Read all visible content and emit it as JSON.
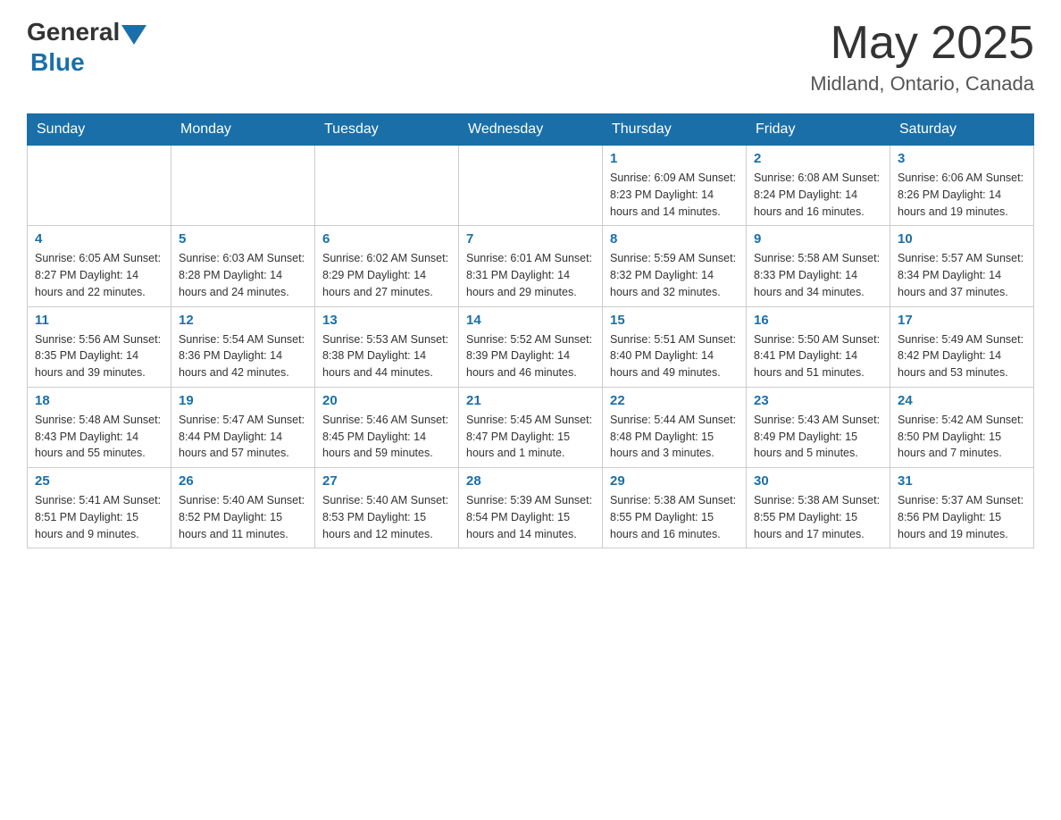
{
  "header": {
    "logo_general": "General",
    "logo_blue": "Blue",
    "month_year": "May 2025",
    "location": "Midland, Ontario, Canada"
  },
  "weekdays": [
    "Sunday",
    "Monday",
    "Tuesday",
    "Wednesday",
    "Thursday",
    "Friday",
    "Saturday"
  ],
  "weeks": [
    [
      {
        "day": "",
        "info": ""
      },
      {
        "day": "",
        "info": ""
      },
      {
        "day": "",
        "info": ""
      },
      {
        "day": "",
        "info": ""
      },
      {
        "day": "1",
        "info": "Sunrise: 6:09 AM\nSunset: 8:23 PM\nDaylight: 14 hours and 14 minutes."
      },
      {
        "day": "2",
        "info": "Sunrise: 6:08 AM\nSunset: 8:24 PM\nDaylight: 14 hours and 16 minutes."
      },
      {
        "day": "3",
        "info": "Sunrise: 6:06 AM\nSunset: 8:26 PM\nDaylight: 14 hours and 19 minutes."
      }
    ],
    [
      {
        "day": "4",
        "info": "Sunrise: 6:05 AM\nSunset: 8:27 PM\nDaylight: 14 hours and 22 minutes."
      },
      {
        "day": "5",
        "info": "Sunrise: 6:03 AM\nSunset: 8:28 PM\nDaylight: 14 hours and 24 minutes."
      },
      {
        "day": "6",
        "info": "Sunrise: 6:02 AM\nSunset: 8:29 PM\nDaylight: 14 hours and 27 minutes."
      },
      {
        "day": "7",
        "info": "Sunrise: 6:01 AM\nSunset: 8:31 PM\nDaylight: 14 hours and 29 minutes."
      },
      {
        "day": "8",
        "info": "Sunrise: 5:59 AM\nSunset: 8:32 PM\nDaylight: 14 hours and 32 minutes."
      },
      {
        "day": "9",
        "info": "Sunrise: 5:58 AM\nSunset: 8:33 PM\nDaylight: 14 hours and 34 minutes."
      },
      {
        "day": "10",
        "info": "Sunrise: 5:57 AM\nSunset: 8:34 PM\nDaylight: 14 hours and 37 minutes."
      }
    ],
    [
      {
        "day": "11",
        "info": "Sunrise: 5:56 AM\nSunset: 8:35 PM\nDaylight: 14 hours and 39 minutes."
      },
      {
        "day": "12",
        "info": "Sunrise: 5:54 AM\nSunset: 8:36 PM\nDaylight: 14 hours and 42 minutes."
      },
      {
        "day": "13",
        "info": "Sunrise: 5:53 AM\nSunset: 8:38 PM\nDaylight: 14 hours and 44 minutes."
      },
      {
        "day": "14",
        "info": "Sunrise: 5:52 AM\nSunset: 8:39 PM\nDaylight: 14 hours and 46 minutes."
      },
      {
        "day": "15",
        "info": "Sunrise: 5:51 AM\nSunset: 8:40 PM\nDaylight: 14 hours and 49 minutes."
      },
      {
        "day": "16",
        "info": "Sunrise: 5:50 AM\nSunset: 8:41 PM\nDaylight: 14 hours and 51 minutes."
      },
      {
        "day": "17",
        "info": "Sunrise: 5:49 AM\nSunset: 8:42 PM\nDaylight: 14 hours and 53 minutes."
      }
    ],
    [
      {
        "day": "18",
        "info": "Sunrise: 5:48 AM\nSunset: 8:43 PM\nDaylight: 14 hours and 55 minutes."
      },
      {
        "day": "19",
        "info": "Sunrise: 5:47 AM\nSunset: 8:44 PM\nDaylight: 14 hours and 57 minutes."
      },
      {
        "day": "20",
        "info": "Sunrise: 5:46 AM\nSunset: 8:45 PM\nDaylight: 14 hours and 59 minutes."
      },
      {
        "day": "21",
        "info": "Sunrise: 5:45 AM\nSunset: 8:47 PM\nDaylight: 15 hours and 1 minute."
      },
      {
        "day": "22",
        "info": "Sunrise: 5:44 AM\nSunset: 8:48 PM\nDaylight: 15 hours and 3 minutes."
      },
      {
        "day": "23",
        "info": "Sunrise: 5:43 AM\nSunset: 8:49 PM\nDaylight: 15 hours and 5 minutes."
      },
      {
        "day": "24",
        "info": "Sunrise: 5:42 AM\nSunset: 8:50 PM\nDaylight: 15 hours and 7 minutes."
      }
    ],
    [
      {
        "day": "25",
        "info": "Sunrise: 5:41 AM\nSunset: 8:51 PM\nDaylight: 15 hours and 9 minutes."
      },
      {
        "day": "26",
        "info": "Sunrise: 5:40 AM\nSunset: 8:52 PM\nDaylight: 15 hours and 11 minutes."
      },
      {
        "day": "27",
        "info": "Sunrise: 5:40 AM\nSunset: 8:53 PM\nDaylight: 15 hours and 12 minutes."
      },
      {
        "day": "28",
        "info": "Sunrise: 5:39 AM\nSunset: 8:54 PM\nDaylight: 15 hours and 14 minutes."
      },
      {
        "day": "29",
        "info": "Sunrise: 5:38 AM\nSunset: 8:55 PM\nDaylight: 15 hours and 16 minutes."
      },
      {
        "day": "30",
        "info": "Sunrise: 5:38 AM\nSunset: 8:55 PM\nDaylight: 15 hours and 17 minutes."
      },
      {
        "day": "31",
        "info": "Sunrise: 5:37 AM\nSunset: 8:56 PM\nDaylight: 15 hours and 19 minutes."
      }
    ]
  ]
}
